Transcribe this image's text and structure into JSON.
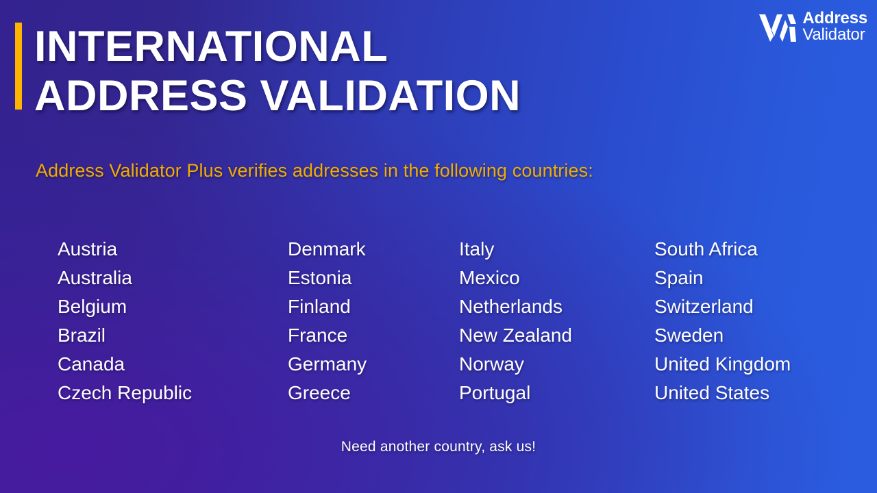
{
  "brand": {
    "logo_icon": "address-validator-logo-mark",
    "name_line1": "Address",
    "name_line2": "Validator"
  },
  "header": {
    "title_line1": "INTERNATIONAL",
    "title_line2": "ADDRESS VALIDATION",
    "accent_color": "#ffb400"
  },
  "subtitle": {
    "text": "Address Validator Plus verifies addresses in the following countries:",
    "color": "#f0ad00"
  },
  "countries": {
    "columns": [
      [
        "Austria",
        "Australia",
        "Belgium",
        "Brazil",
        "Canada",
        "Czech Republic"
      ],
      [
        "Denmark",
        "Estonia",
        "Finland",
        "France",
        "Germany",
        "Greece"
      ],
      [
        "Italy",
        "Mexico",
        "Netherlands",
        "New Zealand",
        "Norway",
        "Portugal"
      ],
      [
        "South Africa",
        "Spain",
        "Switzerland",
        "Sweden",
        "United Kingdom",
        "United States"
      ]
    ]
  },
  "footer": {
    "note": "Need another country, ask us!"
  },
  "theme": {
    "background_left": "#33228f",
    "background_right": "#2b5ce0",
    "text_color": "#ffffff"
  }
}
